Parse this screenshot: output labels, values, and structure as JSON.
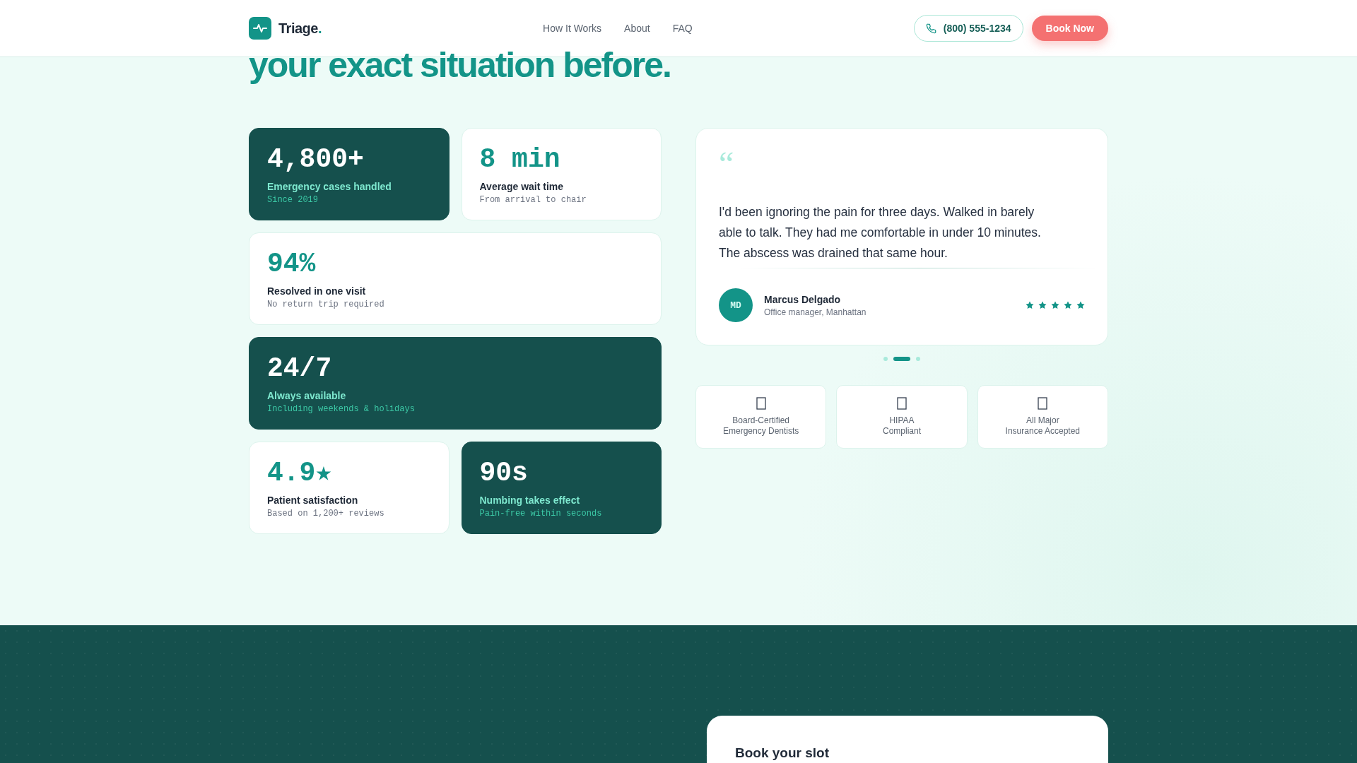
{
  "header": {
    "logo": "Triage",
    "logo_dot": ".",
    "nav": [
      {
        "label": "How It Works"
      },
      {
        "label": "About"
      },
      {
        "label": "FAQ"
      }
    ],
    "phone": "(800) 555-1234",
    "cta": "Book Now"
  },
  "hero": {
    "heading": "your exact situation before."
  },
  "stats": [
    {
      "kind": "dark",
      "value": "4,800+",
      "label": "Emergency cases handled",
      "sub": "Since 2019"
    },
    {
      "kind": "light",
      "value": "8 min",
      "label": "Average wait time",
      "sub": "From arrival to chair"
    },
    {
      "kind": "light",
      "value": "94%",
      "label": "Resolved in one visit",
      "sub": "No return trip required"
    },
    {
      "kind": "dark",
      "value": "24/7",
      "label": "Always available",
      "sub": "Including weekends & holidays"
    },
    {
      "kind": "light",
      "value": "4.9★",
      "label": "Patient satisfaction",
      "sub": "Based on 1,200+ reviews"
    },
    {
      "kind": "dark",
      "value": "90s",
      "label": "Numbing takes effect",
      "sub": "Pain-free within seconds"
    }
  ],
  "testimonial": {
    "quote_mark": "“",
    "text": "I'd been ignoring the pain for three days. Walked in barely able to talk. They had me comfortable in under 10 minutes. The abscess was drained that same hour.",
    "initials": "MD",
    "name": "Marcus Delgado",
    "role": "Office manager, Manhattan",
    "stars": 5
  },
  "carousel_dots": [
    {
      "selected": false
    },
    {
      "selected": true
    },
    {
      "selected": false
    }
  ],
  "badges": [
    {
      "line1": "Board-Certified",
      "line2": "Emergency Dentists"
    },
    {
      "line1": "HIPAA",
      "line2": "Compliant"
    },
    {
      "line1": "All Major",
      "line2": "Insurance Accepted"
    }
  ],
  "booking": {
    "title": "Book your slot"
  }
}
